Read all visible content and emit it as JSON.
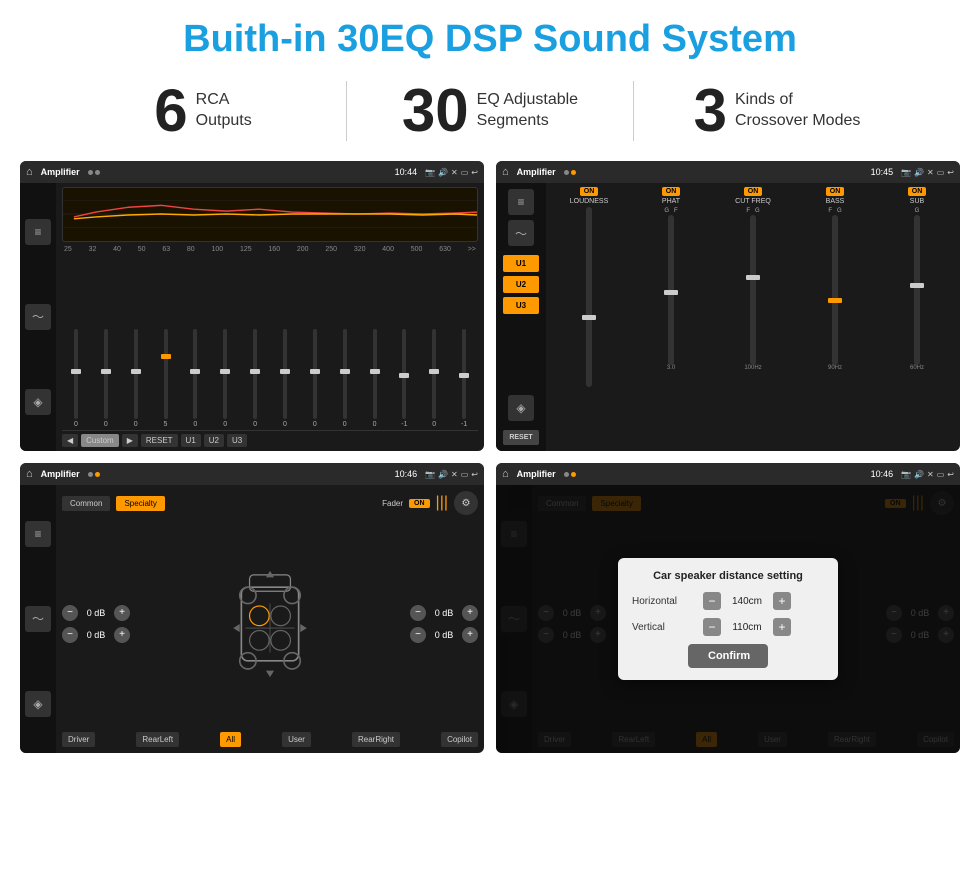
{
  "page": {
    "title": "Buith-in 30EQ DSP Sound System"
  },
  "stats": [
    {
      "number": "6",
      "label_line1": "RCA",
      "label_line2": "Outputs"
    },
    {
      "number": "30",
      "label_line1": "EQ Adjustable",
      "label_line2": "Segments"
    },
    {
      "number": "3",
      "label_line1": "Kinds of",
      "label_line2": "Crossover Modes"
    }
  ],
  "screens": [
    {
      "id": "screen1",
      "topbar": {
        "title": "Amplifier",
        "time": "10:44"
      },
      "eq_labels": [
        "25",
        "32",
        "40",
        "50",
        "63",
        "80",
        "100",
        "125",
        "160",
        "200",
        "250",
        "320",
        "400",
        "500",
        "630"
      ],
      "eq_values": [
        "0",
        "0",
        "0",
        "5",
        "0",
        "0",
        "0",
        "0",
        "0",
        "0",
        "0",
        "-1",
        "0",
        "-1"
      ],
      "bottom_buttons": [
        "◀",
        "Custom",
        "▶",
        "RESET",
        "U1",
        "U2",
        "U3"
      ]
    },
    {
      "id": "screen2",
      "topbar": {
        "title": "Amplifier",
        "time": "10:45"
      },
      "u_buttons": [
        "U1",
        "U2",
        "U3"
      ],
      "channels": [
        "LOUDNESS",
        "PHAT",
        "CUT FREQ",
        "BASS",
        "SUB"
      ],
      "reset_label": "RESET"
    },
    {
      "id": "screen3",
      "topbar": {
        "title": "Amplifier",
        "time": "10:46"
      },
      "tabs": [
        "Common",
        "Specialty"
      ],
      "fader_label": "Fader",
      "db_values": [
        "0 dB",
        "0 dB",
        "0 dB",
        "0 dB"
      ],
      "bottom_buttons": [
        "Driver",
        "RearLeft",
        "All",
        "User",
        "RearRight",
        "Copilot"
      ]
    },
    {
      "id": "screen4",
      "topbar": {
        "title": "Amplifier",
        "time": "10:46"
      },
      "tabs": [
        "Common",
        "Specialty"
      ],
      "dialog": {
        "title": "Car speaker distance setting",
        "horizontal_label": "Horizontal",
        "horizontal_value": "140cm",
        "vertical_label": "Vertical",
        "vertical_value": "110cm",
        "confirm_label": "Confirm"
      },
      "db_values": [
        "0 dB",
        "0 dB"
      ],
      "bottom_buttons": [
        "Driver",
        "RearLeft",
        "All",
        "User",
        "RearRight",
        "Copilot"
      ]
    }
  ]
}
